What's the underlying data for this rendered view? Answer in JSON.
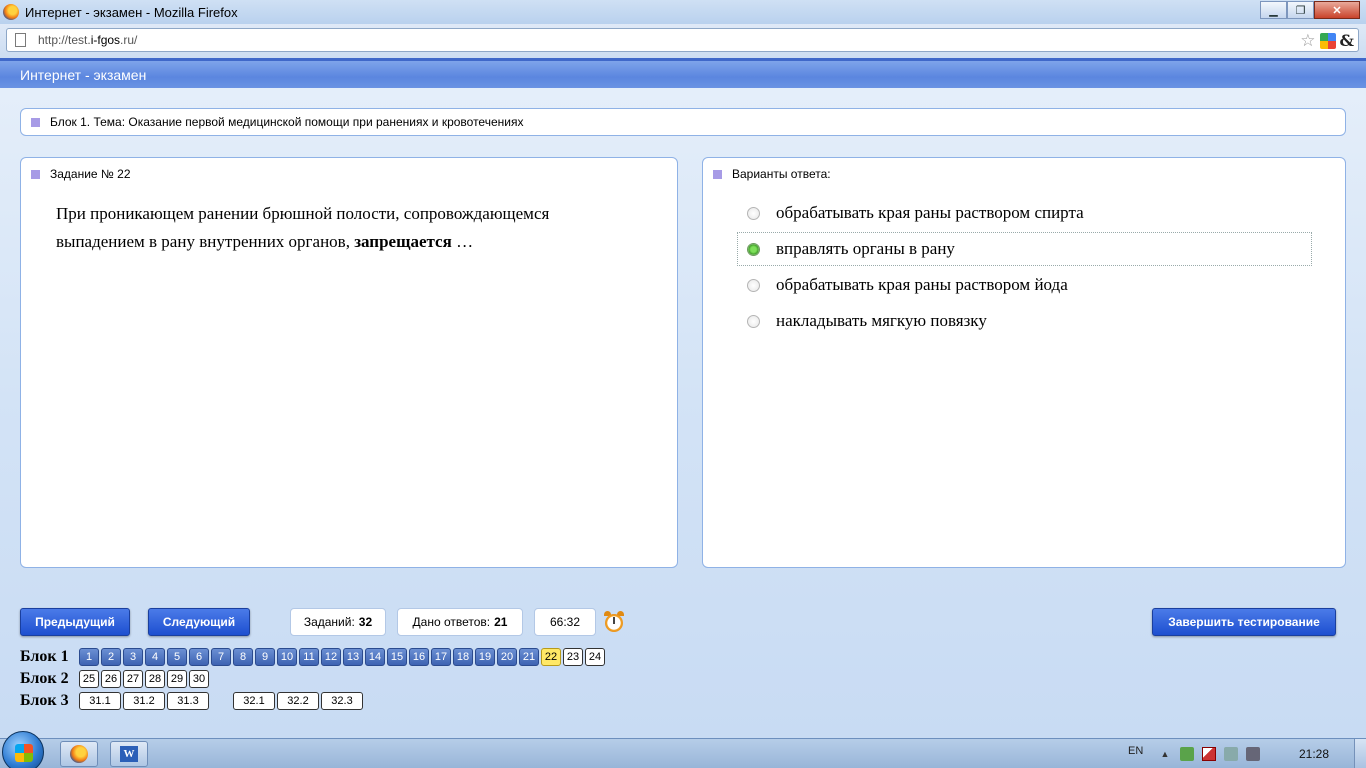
{
  "window": {
    "title": "Интернет - экзамен - Mozilla Firefox",
    "minimize_glyph": "▁",
    "maximize_glyph": "❐",
    "close_glyph": "✕"
  },
  "address_bar": {
    "url_prefix": "http://test.",
    "url_host": "i-fgos",
    "url_suffix": ".ru/",
    "icons": [
      "page-icon",
      "bookmark-star-icon",
      "google-icon",
      "ampersand-icon"
    ],
    "star_glyph": "☆",
    "amp_glyph": "&"
  },
  "header": {
    "title": "Интернет - экзамен"
  },
  "block_topic": "Блок 1. Тема: Оказание первой медицинской помощи при ранениях и кровотечениях",
  "question_panel": {
    "heading": "Задание № 22",
    "text_before": "При проникающем ранении брюшной полости, сопровождающемся выпадением в рану внутренних органов, ",
    "text_bold": "запрещается",
    "text_after": " …"
  },
  "answers_panel": {
    "heading": "Варианты ответа:",
    "options": [
      {
        "label": "обрабатывать края раны раствором спирта",
        "selected": false
      },
      {
        "label": "вправлять органы в рану",
        "selected": true
      },
      {
        "label": "обрабатывать края раны раствором йода",
        "selected": false
      },
      {
        "label": "накладывать мягкую повязку",
        "selected": false
      }
    ]
  },
  "controls": {
    "prev_label": "Предыдущий",
    "next_label": "Следующий",
    "finish_label": "Завершить тестирование",
    "tasks_label": "Заданий:",
    "tasks_value": "32",
    "answered_label": "Дано ответов:",
    "answered_value": "21",
    "timer": "66:32",
    "timer_icon": "alarm-clock-icon"
  },
  "blocks": [
    {
      "label": "Блок 1",
      "items": [
        {
          "n": "1",
          "state": "answered"
        },
        {
          "n": "2",
          "state": "answered"
        },
        {
          "n": "3",
          "state": "answered"
        },
        {
          "n": "4",
          "state": "answered"
        },
        {
          "n": "5",
          "state": "answered"
        },
        {
          "n": "6",
          "state": "answered"
        },
        {
          "n": "7",
          "state": "answered"
        },
        {
          "n": "8",
          "state": "answered"
        },
        {
          "n": "9",
          "state": "answered"
        },
        {
          "n": "10",
          "state": "answered"
        },
        {
          "n": "11",
          "state": "answered"
        },
        {
          "n": "12",
          "state": "answered"
        },
        {
          "n": "13",
          "state": "answered"
        },
        {
          "n": "14",
          "state": "answered"
        },
        {
          "n": "15",
          "state": "answered"
        },
        {
          "n": "16",
          "state": "answered"
        },
        {
          "n": "17",
          "state": "answered"
        },
        {
          "n": "18",
          "state": "answered"
        },
        {
          "n": "19",
          "state": "answered"
        },
        {
          "n": "20",
          "state": "answered"
        },
        {
          "n": "21",
          "state": "answered"
        },
        {
          "n": "22",
          "state": "current"
        },
        {
          "n": "23",
          "state": "open"
        },
        {
          "n": "24",
          "state": "open"
        }
      ]
    },
    {
      "label": "Блок 2",
      "items": [
        {
          "n": "25",
          "state": "open"
        },
        {
          "n": "26",
          "state": "open"
        },
        {
          "n": "27",
          "state": "open"
        },
        {
          "n": "28",
          "state": "open"
        },
        {
          "n": "29",
          "state": "open"
        },
        {
          "n": "30",
          "state": "open"
        }
      ]
    },
    {
      "label": "Блок 3",
      "items": [
        {
          "n": "31.1",
          "state": "open"
        },
        {
          "n": "31.2",
          "state": "open"
        },
        {
          "n": "31.3",
          "state": "open"
        },
        {
          "n": "",
          "state": "gap"
        },
        {
          "n": "32.1",
          "state": "open"
        },
        {
          "n": "32.2",
          "state": "open"
        },
        {
          "n": "32.3",
          "state": "open"
        }
      ]
    }
  ],
  "taskbar": {
    "language": "EN",
    "clock": "21:28",
    "tray_up_glyph": "▲",
    "word_glyph": "W",
    "apps": [
      "firefox-icon",
      "word-icon"
    ]
  },
  "colors": {
    "header_blue": "#5b86df",
    "button_blue": "#1d4fd0",
    "answered_cell": "#3d63b2",
    "current_cell": "#ffe866",
    "selected_radio": "#3c9b25",
    "bullet": "#a79be6"
  }
}
